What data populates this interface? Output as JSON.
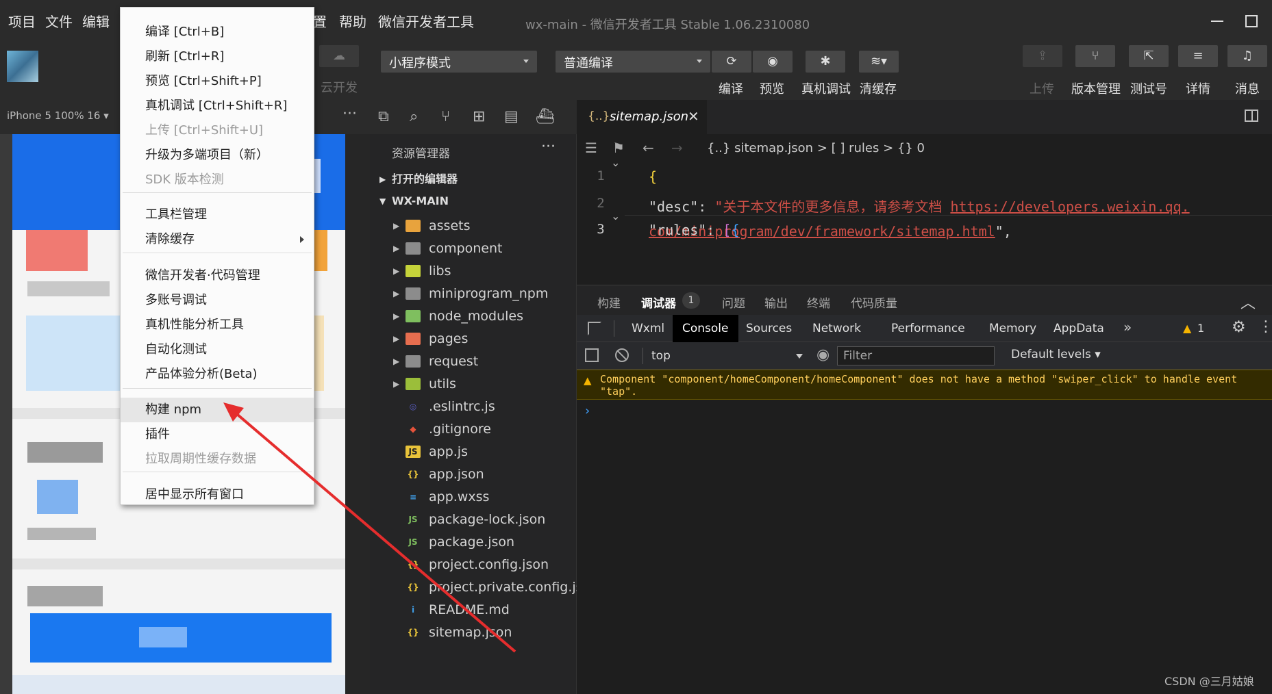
{
  "menubar": {
    "items": [
      "项目",
      "文件",
      "编辑",
      "设置",
      "帮助",
      "微信开发者工具"
    ],
    "window_title": "wx-main - 微信开发者工具 Stable 1.06.2310080"
  },
  "toolbar": {
    "cloud_label": "云开发",
    "mode_select": "小程序模式",
    "compile_select": "普通编译",
    "labels": {
      "compile": "编译",
      "preview": "预览",
      "remote_debug": "真机调试",
      "clear_cache": "清缓存",
      "upload": "上传",
      "version": "版本管理",
      "test": "测试号",
      "details": "详情",
      "messages": "消息"
    }
  },
  "simulator": {
    "device": "iPhone 5 100% 16 ▾",
    "more": "···"
  },
  "context_menu": {
    "items": [
      {
        "label": "编译  [Ctrl+B]",
        "disabled": false
      },
      {
        "label": "刷新  [Ctrl+R]",
        "disabled": false
      },
      {
        "label": "预览  [Ctrl+Shift+P]",
        "disabled": false
      },
      {
        "label": "真机调试  [Ctrl+Shift+R]",
        "disabled": false
      },
      {
        "label": "上传  [Ctrl+Shift+U]",
        "disabled": true
      },
      {
        "label": "升级为多端项目（新）",
        "disabled": false
      },
      {
        "label": "SDK 版本检测",
        "disabled": true
      },
      {
        "label": "工具栏管理",
        "disabled": false
      },
      {
        "label": "清除缓存",
        "disabled": false
      },
      {
        "label": "微信开发者·代码管理",
        "disabled": false
      },
      {
        "label": "多账号调试",
        "disabled": false
      },
      {
        "label": "真机性能分析工具",
        "disabled": false
      },
      {
        "label": "自动化测试",
        "disabled": false
      },
      {
        "label": "产品体验分析(Beta)",
        "disabled": false
      },
      {
        "label": "构建 npm",
        "disabled": false
      },
      {
        "label": "插件",
        "disabled": false
      },
      {
        "label": "拉取周期性缓存数据",
        "disabled": true
      },
      {
        "label": "居中显示所有窗口",
        "disabled": false
      }
    ]
  },
  "explorer": {
    "title": "资源管理器",
    "more": "···",
    "open_editors": "打开的编辑器",
    "project": "WX-MAIN",
    "files": [
      {
        "name": "assets",
        "icon": "folder-assets-icon",
        "color": "#e8a33d",
        "folder": true
      },
      {
        "name": "component",
        "icon": "folder-icon",
        "color": "#8c8c8c",
        "folder": true
      },
      {
        "name": "libs",
        "icon": "folder-libs-icon",
        "color": "#c5d33a",
        "folder": true
      },
      {
        "name": "miniprogram_npm",
        "icon": "folder-icon",
        "color": "#8c8c8c",
        "folder": true
      },
      {
        "name": "node_modules",
        "icon": "folder-node-icon",
        "color": "#7fbf5f",
        "folder": true
      },
      {
        "name": "pages",
        "icon": "folder-pages-icon",
        "color": "#e76e4f",
        "folder": true
      },
      {
        "name": "request",
        "icon": "folder-icon",
        "color": "#8c8c8c",
        "folder": true
      },
      {
        "name": "utils",
        "icon": "folder-utils-icon",
        "color": "#9bbe3a",
        "folder": true
      },
      {
        "name": ".eslintrc.js",
        "icon": "eslint-icon",
        "color": "#5b5fc7",
        "folder": false
      },
      {
        "name": ".gitignore",
        "icon": "git-icon",
        "color": "#e5533b",
        "folder": false
      },
      {
        "name": "app.js",
        "icon": "js-icon",
        "color": "#e8c33a",
        "folder": false
      },
      {
        "name": "app.json",
        "icon": "json-icon",
        "color": "#e8c33a",
        "folder": false
      },
      {
        "name": "app.wxss",
        "icon": "css-icon",
        "color": "#3f9de5",
        "folder": false
      },
      {
        "name": "package-lock.json",
        "icon": "node-icon",
        "color": "#7fbf5f",
        "folder": false
      },
      {
        "name": "package.json",
        "icon": "node-icon",
        "color": "#7fbf5f",
        "folder": false
      },
      {
        "name": "project.config.json",
        "icon": "json-icon",
        "color": "#e8c33a",
        "folder": false
      },
      {
        "name": "project.private.config.js...",
        "icon": "json-icon",
        "color": "#e8c33a",
        "folder": false
      },
      {
        "name": "README.md",
        "icon": "info-icon",
        "color": "#3f9de5",
        "folder": false
      },
      {
        "name": "sitemap.json",
        "icon": "json-icon",
        "color": "#e8c33a",
        "folder": false
      }
    ]
  },
  "editor": {
    "tab_icon": "{..}",
    "tab_label": "sitemap.json",
    "breadcrumb": "{..} sitemap.json > [ ] rules > {} 0",
    "lines": {
      "n1": "1",
      "n2": "2",
      "n3": "3",
      "l1": "{",
      "l2_key": "\"desc\"",
      "l2_colon": ": ",
      "l2_str": "\"关于本文件的更多信息，请参考文档 ",
      "l2_url1": "https://developers.weixin.qq.",
      "l2_url2": "com/miniprogram/dev/framework/sitemap.html",
      "l2_end": "\",",
      "l3_key": "\"rules\"",
      "l3_colon": ": ",
      "l3_open": "[",
      "l3_brace": "{"
    }
  },
  "debugger": {
    "tabs": [
      "构建",
      "调试器",
      "问题",
      "输出",
      "终端",
      "代码质量"
    ],
    "badge": "1",
    "devtools_tabs": [
      "Wxml",
      "Console",
      "Sources",
      "Network",
      "Performance",
      "Memory",
      "AppData"
    ],
    "more": "»",
    "warn_count": "1",
    "context": "top",
    "filter_placeholder": "Filter",
    "levels": "Default levels ▾",
    "warning": "Component \"component/homeComponent/homeComponent\" does not have a method \"swiper_click\" to handle event \"tap\".",
    "prompt": "›"
  },
  "watermark": "CSDN @三月姑娘",
  "colors": {
    "accent_red": "#e52d2d",
    "warn_yellow": "#f5b400",
    "link_blue": "#3fa2ff"
  }
}
